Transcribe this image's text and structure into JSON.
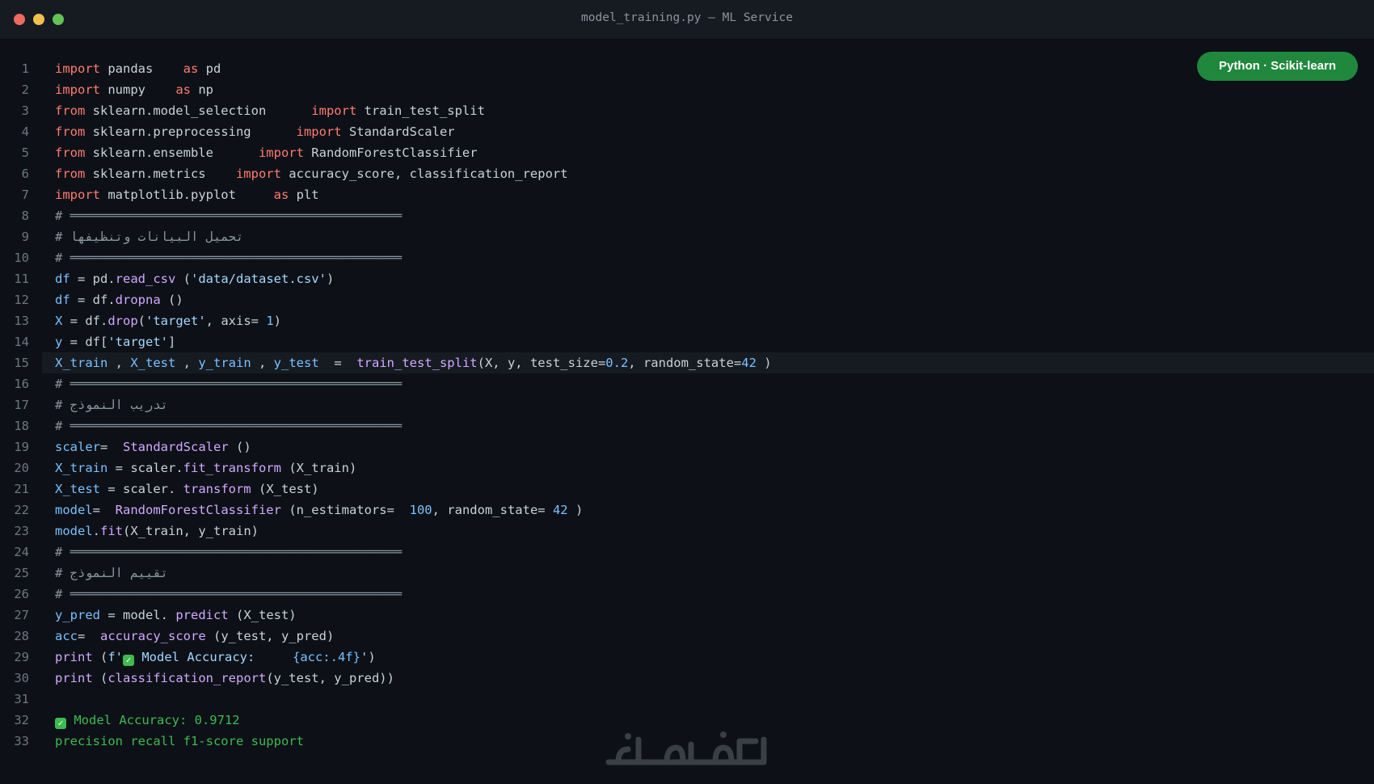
{
  "window": {
    "title": "model_training.py — ML Service"
  },
  "badge": "Python · Scikit-learn",
  "lines": [
    [
      [
        "k",
        "import"
      ],
      [
        "t",
        " pandas    "
      ],
      [
        "k",
        "as"
      ],
      [
        "t",
        " pd"
      ]
    ],
    [
      [
        "k",
        "import"
      ],
      [
        "t",
        " numpy    "
      ],
      [
        "k",
        "as"
      ],
      [
        "t",
        " np"
      ]
    ],
    [
      [
        "k",
        "from"
      ],
      [
        "t",
        " sklearn.model_selection      "
      ],
      [
        "k",
        "import"
      ],
      [
        "t",
        " train_test_split"
      ]
    ],
    [
      [
        "k",
        "from"
      ],
      [
        "t",
        " sklearn.preprocessing      "
      ],
      [
        "k",
        "import"
      ],
      [
        "t",
        " StandardScaler"
      ]
    ],
    [
      [
        "k",
        "from"
      ],
      [
        "t",
        " sklearn.ensemble      "
      ],
      [
        "k",
        "import"
      ],
      [
        "t",
        " RandomForestClassifier"
      ]
    ],
    [
      [
        "k",
        "from"
      ],
      [
        "t",
        " sklearn.metrics    "
      ],
      [
        "k",
        "import"
      ],
      [
        "t",
        " accuracy_score, classification_report"
      ]
    ],
    [
      [
        "k",
        "import"
      ],
      [
        "t",
        " matplotlib.pyplot     "
      ],
      [
        "k",
        "as"
      ],
      [
        "t",
        " plt"
      ]
    ],
    [
      [
        "c",
        "# ════════════════════════════════════════════"
      ]
    ],
    [
      [
        "c",
        "# تحميل البيانات وتنظيفها"
      ]
    ],
    [
      [
        "c",
        "# ════════════════════════════════════════════"
      ]
    ],
    [
      [
        "v",
        "df"
      ],
      [
        "t",
        " = pd."
      ],
      [
        "f",
        "read_csv"
      ],
      [
        "t",
        " ("
      ],
      [
        "s",
        "'data/dataset.csv'"
      ],
      [
        "t",
        ")"
      ]
    ],
    [
      [
        "v",
        "df"
      ],
      [
        "t",
        " = df."
      ],
      [
        "f",
        "dropna"
      ],
      [
        "t",
        " ()"
      ]
    ],
    [
      [
        "v",
        "X"
      ],
      [
        "t",
        " = df."
      ],
      [
        "f",
        "drop"
      ],
      [
        "t",
        "("
      ],
      [
        "s",
        "'target'"
      ],
      [
        "t",
        ", axis= "
      ],
      [
        "n",
        "1"
      ],
      [
        "t",
        ")"
      ]
    ],
    [
      [
        "v",
        "y"
      ],
      [
        "t",
        " = df["
      ],
      [
        "s",
        "'target'"
      ],
      [
        "t",
        "]"
      ]
    ],
    [
      [
        "v",
        "X_train"
      ],
      [
        "t",
        " , "
      ],
      [
        "v",
        "X_test"
      ],
      [
        "t",
        " , "
      ],
      [
        "v",
        "y_train"
      ],
      [
        "t",
        " , "
      ],
      [
        "v",
        "y_test"
      ],
      [
        "t",
        "  =  "
      ],
      [
        "f",
        "train_test_split"
      ],
      [
        "t",
        "(X, y, test_size="
      ],
      [
        "n",
        "0.2"
      ],
      [
        "t",
        ", random_state="
      ],
      [
        "n",
        "42"
      ],
      [
        "t",
        " )"
      ]
    ],
    [
      [
        "c",
        "# ════════════════════════════════════════════"
      ]
    ],
    [
      [
        "c",
        "# تدريب النموذج"
      ]
    ],
    [
      [
        "c",
        "# ════════════════════════════════════════════"
      ]
    ],
    [
      [
        "v",
        "scaler"
      ],
      [
        "t",
        "=  "
      ],
      [
        "f",
        "StandardScaler"
      ],
      [
        "t",
        " ()"
      ]
    ],
    [
      [
        "v",
        "X_train"
      ],
      [
        "t",
        " = scaler."
      ],
      [
        "f",
        "fit_transform"
      ],
      [
        "t",
        " (X_train)"
      ]
    ],
    [
      [
        "v",
        "X_test"
      ],
      [
        "t",
        " = scaler. "
      ],
      [
        "f",
        "transform"
      ],
      [
        "t",
        " (X_test)"
      ]
    ],
    [
      [
        "v",
        "model"
      ],
      [
        "t",
        "=  "
      ],
      [
        "f",
        "RandomForestClassifier"
      ],
      [
        "t",
        " (n_estimators=  "
      ],
      [
        "n",
        "100"
      ],
      [
        "t",
        ", random_state= "
      ],
      [
        "n",
        "42"
      ],
      [
        "t",
        " )"
      ]
    ],
    [
      [
        "v",
        "model"
      ],
      [
        "t",
        "."
      ],
      [
        "f",
        "fit"
      ],
      [
        "t",
        "(X_train, y_train)"
      ]
    ],
    [
      [
        "c",
        "# ════════════════════════════════════════════"
      ]
    ],
    [
      [
        "c",
        "# تقييم النموذج"
      ]
    ],
    [
      [
        "c",
        "# ════════════════════════════════════════════"
      ]
    ],
    [
      [
        "v",
        "y_pred"
      ],
      [
        "t",
        " = model. "
      ],
      [
        "f",
        "predict"
      ],
      [
        "t",
        " (X_test)"
      ]
    ],
    [
      [
        "v",
        "acc"
      ],
      [
        "t",
        "=  "
      ],
      [
        "f",
        "accuracy_score"
      ],
      [
        "t",
        " (y_test, y_pred)"
      ]
    ],
    [
      [
        "f",
        "print"
      ],
      [
        "t",
        " ("
      ],
      [
        "s",
        "f'"
      ],
      [
        "e",
        "✓"
      ],
      [
        "s",
        " Model Accuracy:     "
      ],
      [
        "n",
        "{acc:.4f}"
      ],
      [
        "s",
        "'"
      ],
      [
        "t",
        ")"
      ]
    ],
    [
      [
        "f",
        "print"
      ],
      [
        "t",
        " ("
      ],
      [
        "f",
        "classification_report"
      ],
      [
        "t",
        "(y_test, y_pred))"
      ]
    ],
    [],
    [
      [
        "e",
        "✓"
      ],
      [
        "o",
        " Model Accuracy: 0.9712"
      ]
    ],
    [
      [
        "o",
        "precision recall f1-score support"
      ]
    ]
  ],
  "highlight_line": 15
}
